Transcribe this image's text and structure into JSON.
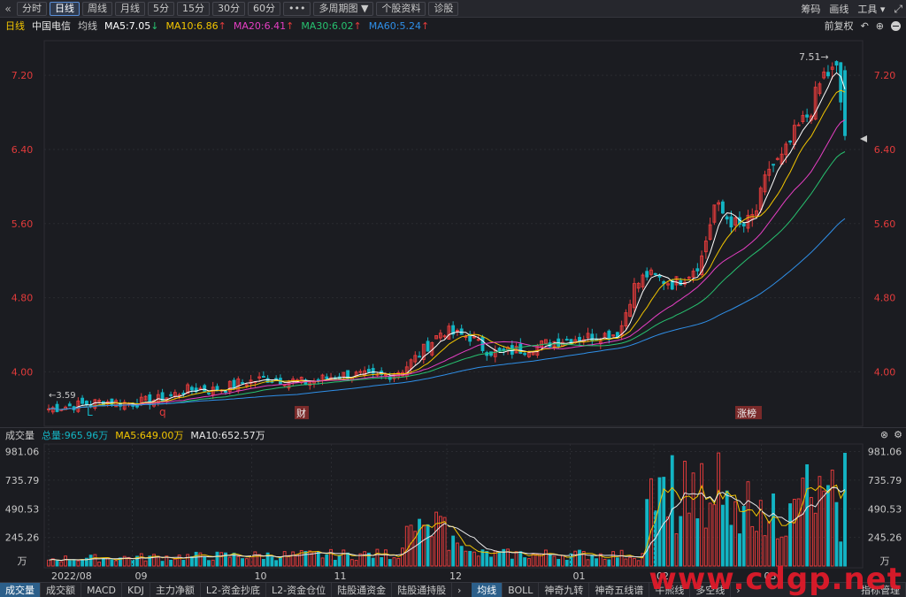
{
  "toolbar": {
    "back_icon": "double-chevron-left-icon",
    "buttons": [
      "分时",
      "日线",
      "周线",
      "月线",
      "5分",
      "15分",
      "30分",
      "60分",
      "•••",
      "多周期图 ▼",
      "个股资料",
      "诊股"
    ],
    "active": "日线",
    "right": [
      "筹码",
      "画线",
      "工具 ▾"
    ]
  },
  "indicator": {
    "period": "日线",
    "stock_name": "中国电信",
    "ma_label": "均线",
    "ma5": "MA5:7.05",
    "ma10": "MA10:6.86",
    "ma20": "MA20:6.41",
    "ma30": "MA30:6.02",
    "ma60": "MA60:5.24",
    "fq": "前复权"
  },
  "colors": {
    "up": "#e23b3b",
    "down": "#13b5c4",
    "ma5": "#ffffff",
    "ma10": "#f2c500",
    "ma20": "#e63fc4",
    "ma30": "#27c270",
    "ma60": "#2f8fe8",
    "axis_text": "#e23b3b"
  },
  "price_axis": [
    "7.20",
    "6.40",
    "5.60",
    "4.80",
    "4.00"
  ],
  "annotations": {
    "high": "7.51→",
    "low": "←3.59",
    "markers": [
      "L",
      "q",
      "财",
      "涨榜"
    ]
  },
  "date_axis": [
    "2022/08",
    "09",
    "10",
    "11",
    "12",
    "01",
    "02",
    "03"
  ],
  "volume": {
    "title": "成交量",
    "total": "总量:965.96万",
    "ma5": "MA5:649.00万",
    "ma10": "MA10:652.57万",
    "axis": [
      "981.06",
      "735.79",
      "490.53",
      "245.26",
      "万"
    ]
  },
  "bottom_tabs": {
    "left": [
      "成交量",
      "成交额",
      "MACD",
      "KDJ",
      "主力净额",
      "L2-资金抄底",
      "L2-资金仓位",
      "陆股通资金",
      "陆股通持股"
    ],
    "right": [
      "均线",
      "BOLL",
      "神奇九转",
      "神奇五线谱",
      "牛熊线",
      "多空线"
    ],
    "active_left": "成交量",
    "active_right": "均线",
    "far_right": "指标管理"
  },
  "watermark": "www.cdgp.net",
  "chart_data": {
    "type": "candlestick",
    "title": "中国电信 日线",
    "ylim": [
      3.45,
      7.65
    ],
    "y_ticks": [
      4.0,
      4.8,
      5.6,
      6.4,
      7.2
    ],
    "volume_ylim": [
      0,
      1000
    ],
    "volume_ticks": [
      245.26,
      490.53,
      735.79,
      981.06
    ],
    "high": 7.51,
    "low": 3.59,
    "months": [
      "2022/08",
      "09",
      "10",
      "11",
      "12",
      "01",
      "02",
      "03"
    ],
    "close_path": [
      [
        0,
        3.6
      ],
      [
        5,
        3.62
      ],
      [
        10,
        3.64
      ],
      [
        15,
        3.66
      ],
      [
        20,
        3.68
      ],
      [
        25,
        3.67
      ],
      [
        30,
        3.66
      ],
      [
        35,
        3.68
      ],
      [
        40,
        3.7
      ],
      [
        45,
        3.74
      ],
      [
        50,
        3.8
      ],
      [
        55,
        3.82
      ],
      [
        60,
        3.8
      ],
      [
        65,
        3.83
      ],
      [
        70,
        3.88
      ],
      [
        75,
        3.9
      ],
      [
        80,
        3.93
      ],
      [
        85,
        3.92
      ],
      [
        90,
        3.9
      ],
      [
        95,
        3.88
      ],
      [
        100,
        3.92
      ],
      [
        105,
        3.95
      ],
      [
        110,
        3.97
      ],
      [
        115,
        3.96
      ],
      [
        120,
        3.94
      ],
      [
        125,
        3.97
      ],
      [
        130,
        4.02
      ],
      [
        135,
        4.15
      ],
      [
        140,
        4.3
      ],
      [
        145,
        4.45
      ],
      [
        150,
        4.4
      ],
      [
        155,
        4.38
      ],
      [
        160,
        4.25
      ],
      [
        165,
        4.2
      ],
      [
        170,
        4.22
      ],
      [
        175,
        4.25
      ],
      [
        180,
        4.28
      ],
      [
        185,
        4.32
      ],
      [
        190,
        4.35
      ],
      [
        195,
        4.37
      ],
      [
        200,
        4.38
      ],
      [
        205,
        4.4
      ],
      [
        210,
        4.42
      ],
      [
        215,
        4.9
      ],
      [
        220,
        5.05
      ],
      [
        225,
        5.0
      ],
      [
        230,
        4.95
      ],
      [
        235,
        5.05
      ],
      [
        240,
        5.2
      ],
      [
        245,
        5.8
      ],
      [
        250,
        5.65
      ],
      [
        255,
        5.55
      ],
      [
        260,
        5.7
      ],
      [
        265,
        6.2
      ],
      [
        270,
        6.3
      ],
      [
        275,
        6.6
      ],
      [
        280,
        6.8
      ],
      [
        285,
        7.2
      ],
      [
        290,
        7.25
      ],
      [
        293,
        6.55
      ]
    ],
    "ma_end": {
      "ma5": 7.05,
      "ma10": 6.86,
      "ma20": 6.41,
      "ma30": 6.02,
      "ma60": 5.24
    },
    "volume_last": 965.96
  }
}
